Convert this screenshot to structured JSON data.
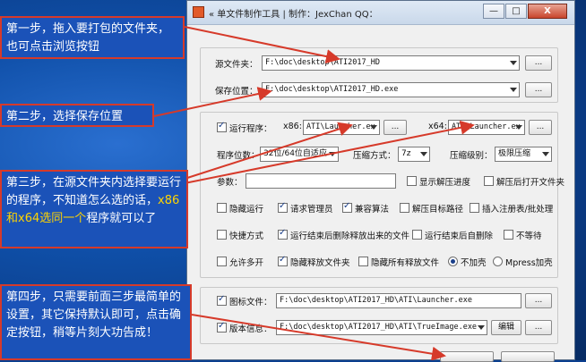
{
  "window": {
    "title": "« 单文件制作工具 | 制作：JexChan QQ：",
    "min_label": "—",
    "max_label": "□",
    "close_label": "X"
  },
  "source": {
    "label": "源文件夹：",
    "value": "F:\\doc\\desktop\\ATI2017_HD",
    "browse": "..."
  },
  "save": {
    "label": "保存位置：",
    "value": "F:\\doc\\desktop\\ATI2017_HD.exe",
    "browse": "..."
  },
  "run": {
    "checkbox_label": "运行程序：",
    "x86_label": "x86:",
    "x86_value": "ATI\\Launcher.ex",
    "x86_browse": "...",
    "x64_label": "x64:",
    "x64_value": "ATI\\Launcher.ex",
    "x64_browse": "..."
  },
  "options": {
    "bitness_label": "程序位数：",
    "bitness_value": "32位/64位自适应",
    "compress_mode_label": "压缩方式：",
    "compress_mode_value": "7z",
    "compress_level_label": "压缩级别：",
    "compress_level_value": "极限压缩",
    "params_label": "参数：",
    "show_progress": "显示解压进度",
    "open_after": "解压后打开文件夹",
    "hidden_run": "隐藏运行",
    "request_admin": "请求管理员",
    "compat_algo": "兼容算法",
    "auto_path": "解压目标路径",
    "insert_reg": "插入注册表/批处理",
    "shortcut": "快捷方式",
    "delete_after": "运行结束后删除释放出来的文件",
    "delete_on_exit": "运行结束后自删除",
    "no_wait": "不等待",
    "allow_multi": "允许多开",
    "hide_release_folder": "隐藏释放文件夹",
    "hide_all_files": "隐藏所有释放文件",
    "no_shell": "不加壳",
    "mpress": "Mpress加壳"
  },
  "icon": {
    "label": "图标文件：",
    "value": "F:\\doc\\desktop\\ATI2017_HD\\ATI\\Launcher.exe",
    "browse": "..."
  },
  "version": {
    "label": "版本信息：",
    "value": "F:\\doc\\desktop\\ATI2017_HD\\ATI\\TrueImage.exe",
    "edit": "编辑",
    "browse": "..."
  },
  "annotations": {
    "step1": "第一步，拖入要打包的文件夹，也可点击浏览按钮",
    "step2": "第二步，选择保存位置",
    "step3_a": "第三步，在源文件夹内选择要运行的程序，不知道怎么选的话，",
    "step3_b": "x86和x64选同一个",
    "step3_c": "程序就可以了",
    "step4": "第四步，只需要前面三步最简单的设置，其它保持默认即可，点击确定按钮，稍等片刻大功告成！"
  },
  "colors": {
    "annotation_bg": "#1b52b8",
    "annotation_border": "#d63a2a",
    "highlight": "#ffd400",
    "arrow": "#d63a2a"
  }
}
